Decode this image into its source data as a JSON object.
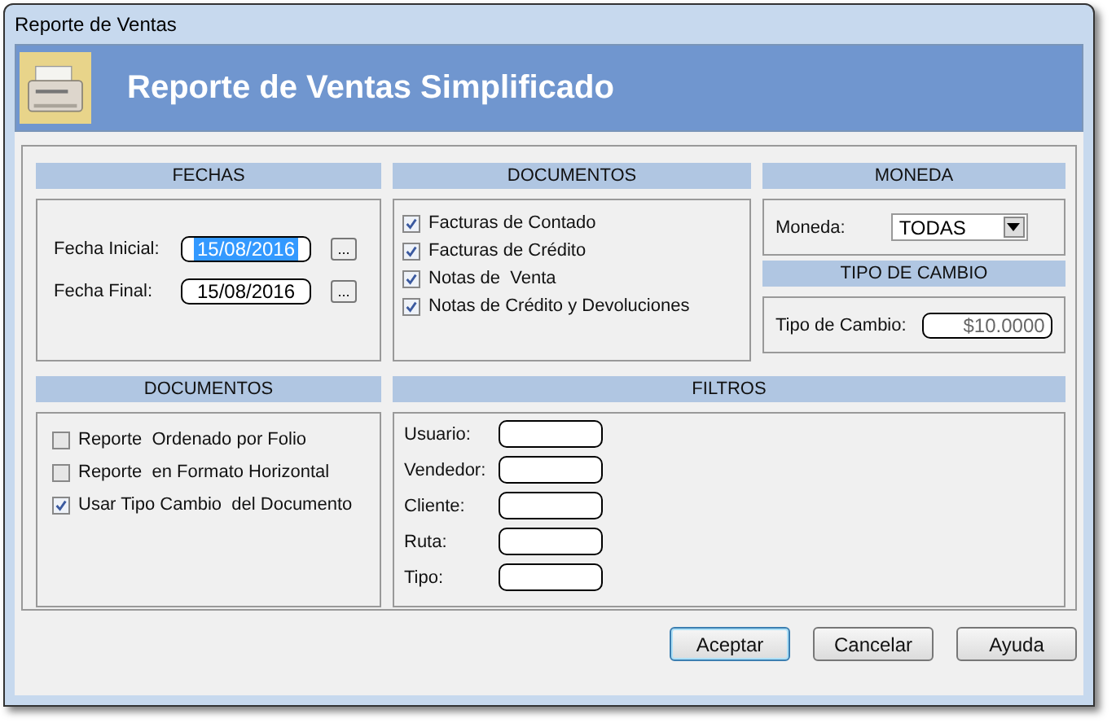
{
  "window": {
    "title": "Reporte de Ventas"
  },
  "header": {
    "title": "Reporte de Ventas Simplificado"
  },
  "fechas": {
    "heading": "FECHAS",
    "fields": [
      {
        "label": "Fecha Inicial:",
        "value": "15/08/2016",
        "selected": true,
        "button": "..."
      },
      {
        "label": "Fecha Final:",
        "value": "15/08/2016",
        "selected": false,
        "button": "..."
      }
    ]
  },
  "documentos": {
    "heading": "DOCUMENTOS",
    "items": [
      {
        "label": "Facturas de Contado",
        "checked": true
      },
      {
        "label": "Facturas de Crédito",
        "checked": true
      },
      {
        "label": "Notas de  Venta",
        "checked": true
      },
      {
        "label": "Notas de Crédito y Devoluciones",
        "checked": true
      }
    ]
  },
  "moneda": {
    "heading": "MONEDA",
    "label": "Moneda:",
    "value": "TODAS"
  },
  "tipo_cambio": {
    "heading": "TIPO DE CAMBIO",
    "label": "Tipo de Cambio:",
    "value": "$10.0000"
  },
  "opciones": {
    "heading": "DOCUMENTOS",
    "items": [
      {
        "label": "Reporte  Ordenado por Folio",
        "checked": false
      },
      {
        "label": "Reporte  en Formato Horizontal",
        "checked": false
      },
      {
        "label": "Usar Tipo Cambio  del Documento",
        "checked": true
      }
    ]
  },
  "filtros": {
    "heading": "FILTROS",
    "fields": [
      {
        "label": "Usuario:"
      },
      {
        "label": "Vendedor:"
      },
      {
        "label": "Cliente:"
      },
      {
        "label": "Ruta:"
      },
      {
        "label": "Tipo:"
      }
    ]
  },
  "buttons": [
    {
      "label": "Aceptar",
      "default": true
    },
    {
      "label": "Cancelar",
      "default": false
    },
    {
      "label": "Ayuda",
      "default": false
    }
  ]
}
